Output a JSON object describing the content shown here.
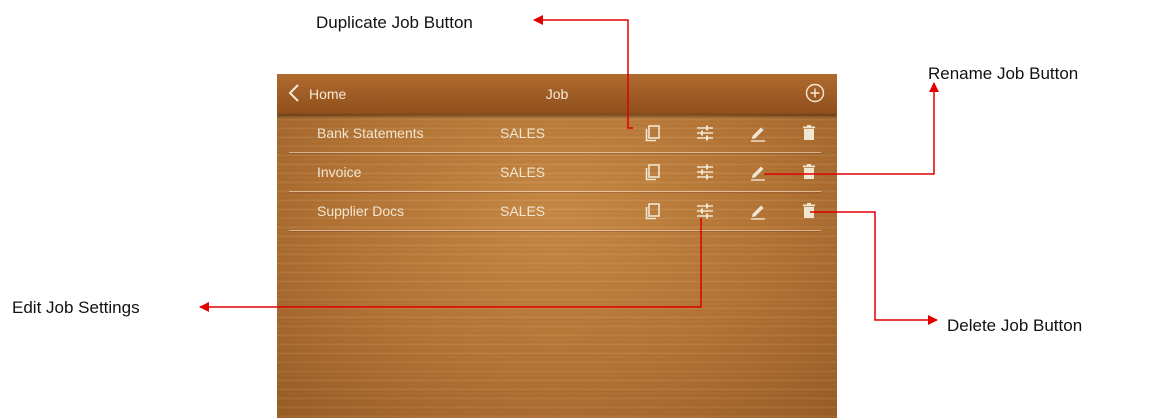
{
  "app": {
    "title": "Job",
    "back_label": "Home"
  },
  "jobs": [
    {
      "name": "Bank Statements",
      "department": "SALES"
    },
    {
      "name": "Invoice",
      "department": "SALES"
    },
    {
      "name": "Supplier Docs",
      "department": "SALES"
    }
  ],
  "callouts": {
    "duplicate": "Duplicate Job Button",
    "rename": "Rename Job Button",
    "edit_settings": "Edit Job Settings",
    "delete": "Delete Job Button"
  },
  "icons": {
    "back": "chevron-left-icon",
    "add": "plus-circle-icon",
    "duplicate": "copy-icon",
    "settings": "sliders-icon",
    "rename": "pencil-icon",
    "delete": "trash-icon"
  },
  "colors": {
    "annotation_line": "#e00000",
    "titlebar": "#9a5824",
    "panel_wood": "#b57535",
    "panel_text": "#f1e6d2"
  }
}
